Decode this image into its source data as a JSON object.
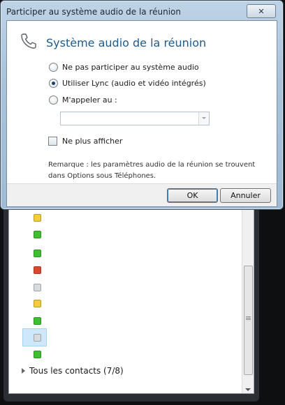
{
  "dialog": {
    "window_title": "Participer au système audio de la réunion",
    "close_label": "✕",
    "heading": "Système audio de la réunion",
    "options": [
      {
        "label": "Ne pas participer au système audio",
        "checked": false
      },
      {
        "label": "Utiliser Lync (audio et vidéo intégrés)",
        "checked": true
      },
      {
        "label": "M'appeler au :",
        "checked": false
      }
    ],
    "phone_value": "",
    "dont_show_label": "Ne plus afficher",
    "remark": "Remarque : les paramètres audio de la réunion se trouvent dans Options sous Téléphones.",
    "ok_label": "OK",
    "cancel_label": "Annuler"
  },
  "contacts": {
    "group_label": "Tous les contacts (7/8)",
    "presence": [
      "yellow",
      "green",
      "green",
      "red",
      "gray",
      "yellow",
      "green",
      "gray",
      "green"
    ]
  },
  "colors": {
    "heading": "#1e5a8c",
    "presence_green": "#3fbf2f",
    "presence_yellow": "#f3cc3d",
    "presence_red": "#d9482d",
    "presence_gray": "#d5dbe0"
  }
}
